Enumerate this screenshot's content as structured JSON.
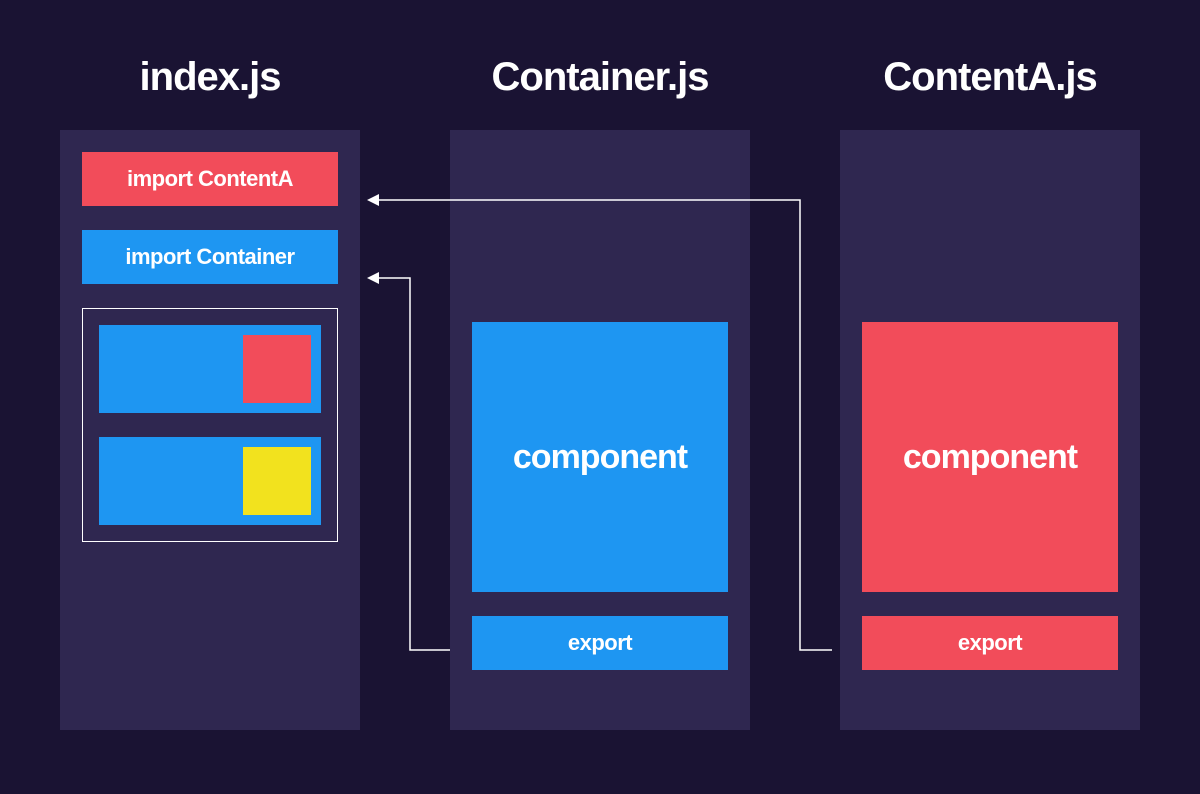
{
  "columns": {
    "index": {
      "title": "index.js",
      "import1": "import ContentA",
      "import2": "import Container"
    },
    "container": {
      "title": "Container.js",
      "component_label": "component",
      "export_label": "export"
    },
    "contenta": {
      "title": "ContentA.js",
      "component_label": "component",
      "export_label": "export"
    }
  },
  "colors": {
    "red": "#f24c5a",
    "blue": "#1e96f2",
    "yellow": "#f2e21e",
    "panel": "#2f2750",
    "bg": "#1a1333"
  }
}
